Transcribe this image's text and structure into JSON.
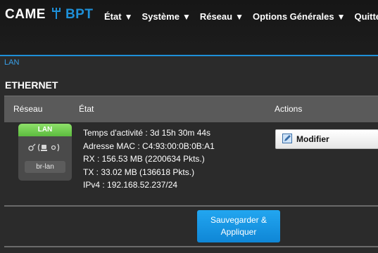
{
  "brand": {
    "came": "CAME",
    "bpt": "BPT",
    "mark_icon": "trident-icon"
  },
  "nav": {
    "etat": "État",
    "systeme": "Système",
    "reseau": "Réseau",
    "options": "Options Générales",
    "quitter": "Quitter",
    "arrow": "▼"
  },
  "breadcrumb": "LAN",
  "section_title": "ETHERNET",
  "table": {
    "headers": {
      "reseau": "Réseau",
      "etat": "État",
      "actions": "Actions"
    },
    "row": {
      "badge_label": "LAN",
      "badge_icons": "\u0001\u0001 (\u0001 \u0001)",
      "badge_interface": "br-lan",
      "status_lines": [
        "Temps d'activité : 3d 15h 30m 44s",
        "Adresse MAC : C4:93:00:0B:0B:A1",
        "RX : 156.53 MB (2200634 Pkts.)",
        "TX : 33.02 MB (136618 Pkts.)",
        "IPv4 : 192.168.52.237/24"
      ],
      "edit_label": "Modifier"
    }
  },
  "save_apply": {
    "line1": "Sauvegarder &",
    "line2": "Appliquer"
  },
  "colors": {
    "accent": "#1e90d8",
    "lan_green": "#5cbc3e",
    "background": "#2b2b2b"
  }
}
